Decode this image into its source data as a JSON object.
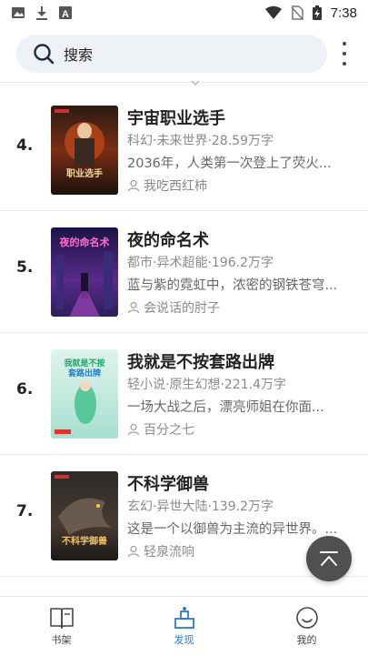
{
  "status": {
    "time": "7:38"
  },
  "search": {
    "label": "搜索"
  },
  "books": [
    {
      "rank": "4.",
      "title": "宇宙职业选手",
      "meta": "科幻·未来世界·28.59万字",
      "desc": "2036年，人类第一次登上了荧火...",
      "author": "我吃西红柿"
    },
    {
      "rank": "5.",
      "title": "夜的命名术",
      "meta": "都市·异术超能·196.2万字",
      "desc": "蓝与紫的霓虹中，浓密的钢铁苍穹...",
      "author": "会说话的肘子"
    },
    {
      "rank": "6.",
      "title": "我就是不按套路出牌",
      "meta": "轻小说·原生幻想·221.4万字",
      "desc": "一场大战之后，漂亮师姐在你面...",
      "author": "百分之七"
    },
    {
      "rank": "7.",
      "title": "不科学御兽",
      "meta": "玄幻·异世大陆·139.2万字",
      "desc": "这是一个以御兽为主流的异世界。...",
      "author": "轻泉流响"
    }
  ],
  "nav": [
    {
      "label": "书架",
      "icon": "book-icon"
    },
    {
      "label": "发现",
      "icon": "discover-icon",
      "active": true
    },
    {
      "label": "我的",
      "icon": "profile-icon"
    }
  ],
  "colors": {
    "accent": "#2979d9",
    "fab": "#505050"
  }
}
